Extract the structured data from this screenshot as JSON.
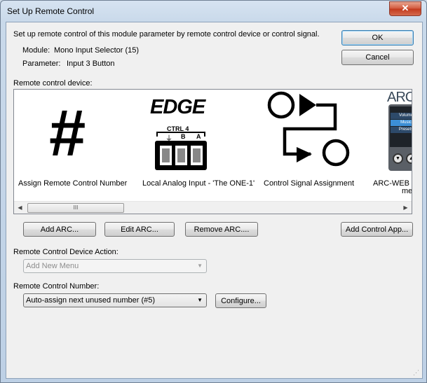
{
  "window": {
    "title": "Set Up Remote Control",
    "close_glyph": "✕"
  },
  "intro": "Set up remote control of this module parameter by remote control device or control signal.",
  "module": {
    "label": "Module:",
    "value": "Mono Input Selector (15)"
  },
  "parameter": {
    "label": "Parameter:",
    "value": "Input 3 Button"
  },
  "buttons": {
    "ok": "OK",
    "cancel": "Cancel"
  },
  "device_section_label": "Remote control device:",
  "devices": [
    {
      "label": "Assign Remote Control Number",
      "icon": "hash-icon",
      "glyph": "#"
    },
    {
      "label": "Local Analog Input - 'The ONE-1'",
      "icon": "edge-ctrl-connector-icon",
      "brand": "EDGE",
      "connector_title": "CTRL 4",
      "pins": [
        "B",
        "A"
      ]
    },
    {
      "label": "Control Signal Assignment",
      "icon": "control-signal-flow-icon"
    },
    {
      "label": "ARC-WEB (A",
      "label2": "me",
      "icon": "arc-web-device-icon",
      "brand": "ARC",
      "menu_items": [
        "Volume",
        "Music",
        "Presets"
      ]
    }
  ],
  "scroll_thumb_glyph": "III",
  "device_buttons": {
    "add_arc": "Add ARC...",
    "edit_arc": "Edit ARC...",
    "remove_arc": "Remove ARC....",
    "add_control_app": "Add Control App..."
  },
  "action": {
    "label": "Remote Control Device Action:",
    "value": "Add New Menu"
  },
  "number": {
    "label": "Remote Control Number:",
    "value": "Auto-assign next unused number (#5)",
    "configure": "Configure..."
  }
}
